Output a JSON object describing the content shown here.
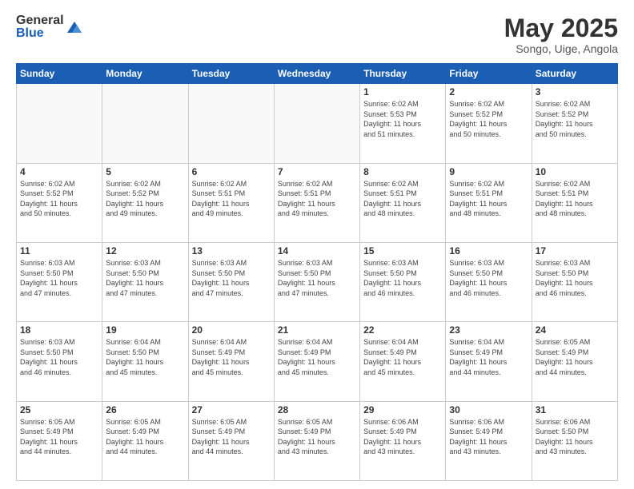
{
  "header": {
    "logo": {
      "general": "General",
      "blue": "Blue"
    },
    "title": "May 2025",
    "subtitle": "Songo, Uige, Angola"
  },
  "calendar": {
    "days_of_week": [
      "Sunday",
      "Monday",
      "Tuesday",
      "Wednesday",
      "Thursday",
      "Friday",
      "Saturday"
    ],
    "weeks": [
      [
        {
          "day": "",
          "info": ""
        },
        {
          "day": "",
          "info": ""
        },
        {
          "day": "",
          "info": ""
        },
        {
          "day": "",
          "info": ""
        },
        {
          "day": "1",
          "info": "Sunrise: 6:02 AM\nSunset: 5:53 PM\nDaylight: 11 hours\nand 51 minutes."
        },
        {
          "day": "2",
          "info": "Sunrise: 6:02 AM\nSunset: 5:52 PM\nDaylight: 11 hours\nand 50 minutes."
        },
        {
          "day": "3",
          "info": "Sunrise: 6:02 AM\nSunset: 5:52 PM\nDaylight: 11 hours\nand 50 minutes."
        }
      ],
      [
        {
          "day": "4",
          "info": "Sunrise: 6:02 AM\nSunset: 5:52 PM\nDaylight: 11 hours\nand 50 minutes."
        },
        {
          "day": "5",
          "info": "Sunrise: 6:02 AM\nSunset: 5:52 PM\nDaylight: 11 hours\nand 49 minutes."
        },
        {
          "day": "6",
          "info": "Sunrise: 6:02 AM\nSunset: 5:51 PM\nDaylight: 11 hours\nand 49 minutes."
        },
        {
          "day": "7",
          "info": "Sunrise: 6:02 AM\nSunset: 5:51 PM\nDaylight: 11 hours\nand 49 minutes."
        },
        {
          "day": "8",
          "info": "Sunrise: 6:02 AM\nSunset: 5:51 PM\nDaylight: 11 hours\nand 48 minutes."
        },
        {
          "day": "9",
          "info": "Sunrise: 6:02 AM\nSunset: 5:51 PM\nDaylight: 11 hours\nand 48 minutes."
        },
        {
          "day": "10",
          "info": "Sunrise: 6:02 AM\nSunset: 5:51 PM\nDaylight: 11 hours\nand 48 minutes."
        }
      ],
      [
        {
          "day": "11",
          "info": "Sunrise: 6:03 AM\nSunset: 5:50 PM\nDaylight: 11 hours\nand 47 minutes."
        },
        {
          "day": "12",
          "info": "Sunrise: 6:03 AM\nSunset: 5:50 PM\nDaylight: 11 hours\nand 47 minutes."
        },
        {
          "day": "13",
          "info": "Sunrise: 6:03 AM\nSunset: 5:50 PM\nDaylight: 11 hours\nand 47 minutes."
        },
        {
          "day": "14",
          "info": "Sunrise: 6:03 AM\nSunset: 5:50 PM\nDaylight: 11 hours\nand 47 minutes."
        },
        {
          "day": "15",
          "info": "Sunrise: 6:03 AM\nSunset: 5:50 PM\nDaylight: 11 hours\nand 46 minutes."
        },
        {
          "day": "16",
          "info": "Sunrise: 6:03 AM\nSunset: 5:50 PM\nDaylight: 11 hours\nand 46 minutes."
        },
        {
          "day": "17",
          "info": "Sunrise: 6:03 AM\nSunset: 5:50 PM\nDaylight: 11 hours\nand 46 minutes."
        }
      ],
      [
        {
          "day": "18",
          "info": "Sunrise: 6:03 AM\nSunset: 5:50 PM\nDaylight: 11 hours\nand 46 minutes."
        },
        {
          "day": "19",
          "info": "Sunrise: 6:04 AM\nSunset: 5:50 PM\nDaylight: 11 hours\nand 45 minutes."
        },
        {
          "day": "20",
          "info": "Sunrise: 6:04 AM\nSunset: 5:49 PM\nDaylight: 11 hours\nand 45 minutes."
        },
        {
          "day": "21",
          "info": "Sunrise: 6:04 AM\nSunset: 5:49 PM\nDaylight: 11 hours\nand 45 minutes."
        },
        {
          "day": "22",
          "info": "Sunrise: 6:04 AM\nSunset: 5:49 PM\nDaylight: 11 hours\nand 45 minutes."
        },
        {
          "day": "23",
          "info": "Sunrise: 6:04 AM\nSunset: 5:49 PM\nDaylight: 11 hours\nand 44 minutes."
        },
        {
          "day": "24",
          "info": "Sunrise: 6:05 AM\nSunset: 5:49 PM\nDaylight: 11 hours\nand 44 minutes."
        }
      ],
      [
        {
          "day": "25",
          "info": "Sunrise: 6:05 AM\nSunset: 5:49 PM\nDaylight: 11 hours\nand 44 minutes."
        },
        {
          "day": "26",
          "info": "Sunrise: 6:05 AM\nSunset: 5:49 PM\nDaylight: 11 hours\nand 44 minutes."
        },
        {
          "day": "27",
          "info": "Sunrise: 6:05 AM\nSunset: 5:49 PM\nDaylight: 11 hours\nand 44 minutes."
        },
        {
          "day": "28",
          "info": "Sunrise: 6:05 AM\nSunset: 5:49 PM\nDaylight: 11 hours\nand 43 minutes."
        },
        {
          "day": "29",
          "info": "Sunrise: 6:06 AM\nSunset: 5:49 PM\nDaylight: 11 hours\nand 43 minutes."
        },
        {
          "day": "30",
          "info": "Sunrise: 6:06 AM\nSunset: 5:49 PM\nDaylight: 11 hours\nand 43 minutes."
        },
        {
          "day": "31",
          "info": "Sunrise: 6:06 AM\nSunset: 5:50 PM\nDaylight: 11 hours\nand 43 minutes."
        }
      ]
    ]
  }
}
